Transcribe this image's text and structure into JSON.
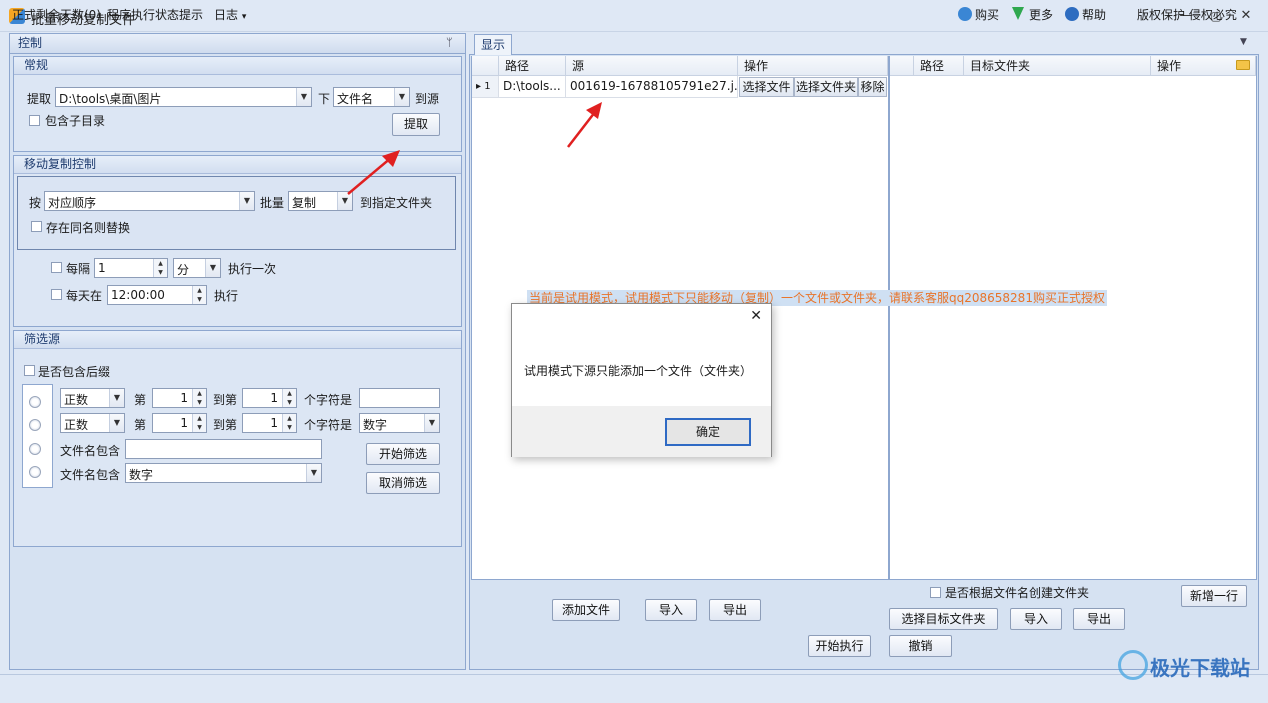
{
  "window": {
    "title": "批量移动复制文件",
    "minimize": "—",
    "maximize": "▢",
    "close": "✕"
  },
  "left": {
    "title": "控制",
    "pin": "ᛘ",
    "general": {
      "title": "常规",
      "extract_label": "提取",
      "path_value": "D:\\tools\\桌面\\图片",
      "under_label": "下",
      "type_value": "文件名",
      "to_source_label": "到源",
      "include_subdir": "包含子目录",
      "extract_button": "提取"
    },
    "move": {
      "title": "移动复制控制",
      "by_label": "按",
      "order_value": "对应顺序",
      "batch_label": "批量",
      "mode_value": "复制",
      "to_folder_label": "到指定文件夹",
      "replace_same": "存在同名则替换",
      "every_label": "每隔",
      "every_value": "1",
      "unit_value": "分",
      "exec_once": "执行一次",
      "daily_label": "每天在",
      "daily_value": "12:00:00",
      "exec_label": "执行"
    },
    "filter": {
      "title": "筛选源",
      "include_ext": "是否包含后缀",
      "row1": {
        "type": "正数",
        "di": "第",
        "from": "1",
        "to_label": "到第",
        "to": "1",
        "chars_label": "个字符是",
        "value": ""
      },
      "row2": {
        "type": "正数",
        "di": "第",
        "from": "1",
        "to_label": "到第",
        "to": "1",
        "chars_label": "个字符是",
        "value": "数字"
      },
      "name_contains1": "文件名包含",
      "name_contains2": "文件名包含",
      "name_value2": "数字",
      "start_button": "开始筛选",
      "cancel_button": "取消筛选"
    }
  },
  "right": {
    "tab": "显示",
    "dropdown": "▼",
    "source_grid": {
      "headers": [
        "路径",
        "源",
        "操作"
      ],
      "row": {
        "marker": "▸",
        "num": "1",
        "path": "D:\\tools...",
        "source": "001619-16788105791e27.j...",
        "actions": [
          "选择文件",
          "选择文件夹",
          "移除"
        ]
      }
    },
    "target_grid": {
      "headers": [
        "路径",
        "目标文件夹",
        "操作"
      ]
    },
    "trial_notice": "当前是试用模式，试用模式下只能移动（复制）一个文件或文件夹，请联系客服qq208658281购买正式授权",
    "buttons": {
      "add_file": "添加文件",
      "import_left": "导入",
      "export_left": "导出",
      "create_by_name": "是否根据文件名创建文件夹",
      "add_row": "新增一行",
      "select_target": "选择目标文件夹",
      "import_right": "导入",
      "export_right": "导出",
      "start_exec": "开始执行",
      "undo": "撤销"
    }
  },
  "dialog": {
    "close": "✕",
    "message": "试用模式下源只能添加一个文件（文件夹）",
    "ok": "确定"
  },
  "status": {
    "days_left": "正式剩余天数(0)",
    "exec_status": "程序执行状态提示",
    "log": "日志",
    "log_arrow": "▾",
    "buy": "购买",
    "more": "更多",
    "help": "帮助",
    "copyright": "版权保护 侵权必究",
    "watermark": "极光下载站"
  },
  "colors": {
    "accent": "#3a6ec4",
    "notice": "#e8742a",
    "arrow": "#e02020"
  }
}
